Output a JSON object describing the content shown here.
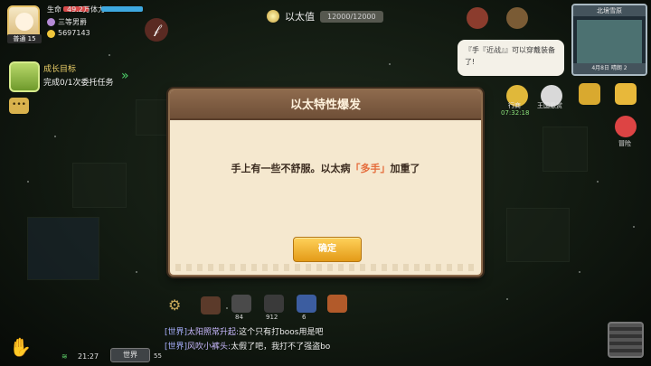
{
  "hud": {
    "level": "普通 15",
    "stat_label_1": "生命",
    "stat_value_1": "49.2万",
    "stat_label_2": "体力",
    "title_name": "三等男爵",
    "gold": "5697143"
  },
  "ether": {
    "label": "以太值",
    "value": "12000/12000"
  },
  "goal": {
    "title": "成长目标",
    "desc": "完成0/1次委托任务"
  },
  "bubble": {
    "text": "『手『近战』』可以穿戴装备了!"
  },
  "minimap": {
    "title": "北境雪原",
    "footer": "4月8日 晴朗 2"
  },
  "side": {
    "item1": "行商",
    "item1_time": "07:32:18",
    "item2": "王国悬赏",
    "item3": "冒险"
  },
  "dialog": {
    "title": "以太特性爆发",
    "body_prefix": "手上有一些不舒服。以太病",
    "body_highlight": "「多手」",
    "body_suffix": "加重了",
    "confirm": "确定"
  },
  "tools": {
    "count1": "84",
    "count2": "912",
    "count3": "6"
  },
  "chat": {
    "line1_channel": "[世界]",
    "line1_name": "太阳照常升起:",
    "line1_msg": "这个只有打boos用是吧",
    "line2_channel": "[世界]",
    "line2_name": "风吹小裤头:",
    "line2_msg": "太假了吧，我打不了强盗bo"
  },
  "bottom": {
    "time": "21:27",
    "world": "世界",
    "count": "55"
  },
  "colors": {
    "dialog_bg": "#f5e8cf",
    "dialog_header": "#7f5c42",
    "confirm_btn": "#f0b02c",
    "highlight": "#e56b3a"
  }
}
